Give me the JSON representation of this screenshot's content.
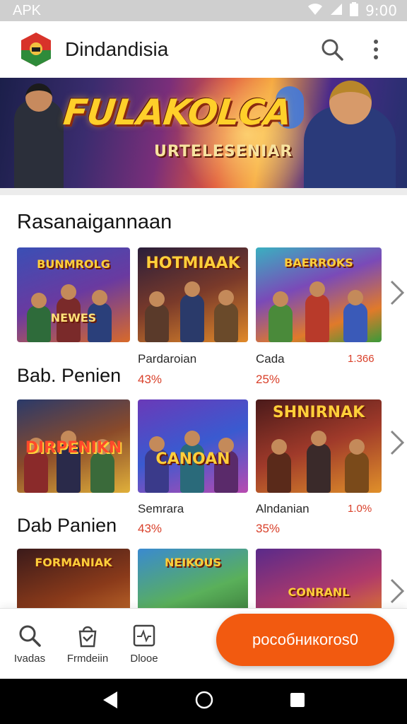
{
  "status_bar": {
    "left_text": "APK",
    "time": "9:00",
    "icons": [
      "wifi-icon",
      "signal-icon",
      "battery-icon"
    ]
  },
  "app_bar": {
    "title": "Dindandisia",
    "icons": [
      "search-icon",
      "more-vert-icon"
    ]
  },
  "banner": {
    "title": "FULAKOLCA",
    "subtitle": "URTELESENIAR"
  },
  "section": {
    "title": "Rasanaigannaan"
  },
  "rows": [
    {
      "label": "Bab. Penien",
      "tiles": [
        {
          "title": "BUNMROLG",
          "subtitle": "NEWES"
        },
        {
          "title": "HOTMIAAK"
        },
        {
          "title": "BAERROKS"
        }
      ],
      "meta": [
        {
          "name": "Pardaroian",
          "pct": "43%"
        },
        {
          "name": "Cada",
          "pct": "25%",
          "extra": "1.366"
        }
      ]
    },
    {
      "label": "Dab Panien",
      "tiles": [
        {
          "title": "DIRPENIKN"
        },
        {
          "title": "CANOAN"
        },
        {
          "title": "SHNIRNAK"
        }
      ],
      "meta": [
        {
          "name": "Semrara",
          "pct": "43%"
        },
        {
          "name": "Alndanian",
          "pct": "35%",
          "extra": "1.0%"
        }
      ]
    },
    {
      "tiles": [
        {
          "title": "FORMANIAK"
        },
        {
          "title": "NEIKOUS"
        },
        {
          "title": "CONRANL"
        }
      ]
    }
  ],
  "bottom_nav": {
    "items": [
      {
        "label": "Ivadas",
        "icon": "search-icon"
      },
      {
        "label": "Frmdeiin",
        "icon": "bag-icon"
      },
      {
        "label": "Dlooe",
        "icon": "activity-icon"
      }
    ],
    "cta_label": "pособникоrоs0"
  },
  "colors": {
    "accent": "#f25a10",
    "percent": "#d9402a",
    "status_bar": "#cfcfcf"
  }
}
